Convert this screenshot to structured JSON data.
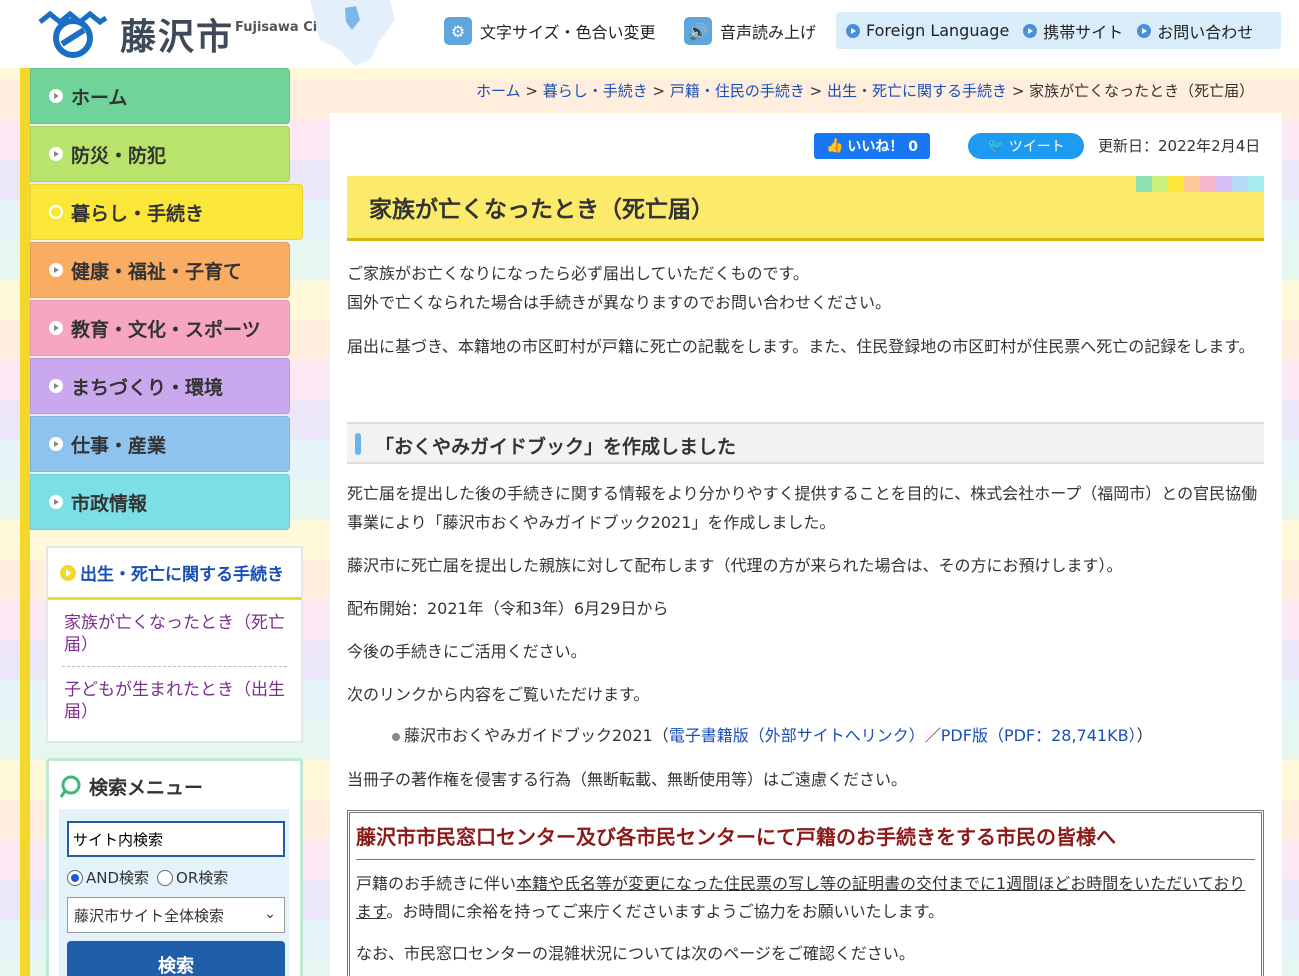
{
  "header": {
    "logo_text": "藤沢市",
    "logo_sub": "Fujisawa City",
    "tools": [
      {
        "label": "文字サイズ・色合い変更",
        "icon": "gear-icon"
      },
      {
        "label": "音声読み上げ",
        "icon": "speaker-icon"
      }
    ],
    "lang_links": [
      "Foreign Language",
      "携帯サイト",
      "お問い合わせ"
    ]
  },
  "nav": [
    {
      "label": "ホーム",
      "color": "#6fd39a"
    },
    {
      "label": "防災・防犯",
      "color": "#b8e46c"
    },
    {
      "label": "暮らし・手続き",
      "color": "#fbe73a"
    },
    {
      "label": "健康・福祉・子育て",
      "color": "#f9ad62"
    },
    {
      "label": "教育・文化・スポーツ",
      "color": "#f7a6c1"
    },
    {
      "label": "まちづくり・環境",
      "color": "#caa8ee"
    },
    {
      "label": "仕事・産業",
      "color": "#8ec3f0"
    },
    {
      "label": "市政情報",
      "color": "#7ddfe6"
    }
  ],
  "subnav": {
    "title": "出生・死亡に関する手続き",
    "items": [
      "家族が亡くなったとき（死亡届）",
      "子どもが生まれたとき（出生届）"
    ]
  },
  "search": {
    "title": "検索メニュー",
    "input_value": "サイト内検索",
    "radio_and": "AND検索",
    "radio_or": "OR検索",
    "scope": "藤沢市サイト全体検索",
    "button": "検索"
  },
  "breadcrumb": {
    "links": [
      "ホーム",
      "暮らし・手続き",
      "戸籍・住民の手続き",
      "出生・死亡に関する手続き"
    ],
    "current": "家族が亡くなったとき（死亡届）",
    "sep": ">"
  },
  "social": {
    "like": "いいね！ 0",
    "tweet": "ツイート"
  },
  "updated": "更新日：2022年2月4日",
  "title": "家族が亡くなったとき（死亡届）",
  "intro": [
    "ご家族がお亡くなりになったら必ず届出していただくものです。",
    "国外で亡くなられた場合は手続きが異なりますのでお問い合わせください。"
  ],
  "para2": "届出に基づき、本籍地の市区町村が戸籍に死亡の記載をします。また、住民登録地の市区町村が住民票へ死亡の記録をします。",
  "section_heading": "「おくやみガイドブック」を作成しました",
  "section": {
    "p1": "死亡届を提出した後の手続きに関する情報をより分かりやすく提供することを目的に、株式会社ホープ（福岡市）との官民協働事業により「藤沢市おくやみガイドブック2021」を作成しました。",
    "p2": "藤沢市に死亡届を提出した親族に対して配布します（代理の方が来られた場合は、その方にお預けします）。",
    "p3": "配布開始：2021年（令和3年）6月29日から",
    "p4": "今後の手続きにご活用ください。",
    "p5": "次のリンクから内容をご覧いただけます。",
    "bullet_prefix": "藤沢市おくやみガイドブック2021（",
    "bullet_link1": "電子書籍版（外部サイトへリンク）",
    "bullet_mid": "／",
    "bullet_link2": "PDF版（PDF：28,741KB）",
    "bullet_suffix": "）",
    "p6": "当冊子の著作権を侵害する行為（無断転載、無断使用等）はご遠慮ください。"
  },
  "notice": {
    "title": "藤沢市市民窓口センター及び各市民センターにて戸籍のお手続きをする市民の皆様へ",
    "b1_pre": "戸籍のお手続きに伴い",
    "b1_under": "本籍や氏名等が変更になった住民票の写し等の証明書の交付までに1週間ほどお時間をいただいております",
    "b1_post": "。お時間に余裕を持ってご来庁くださいますようご協力をお願いいたします。",
    "b2": "なお、市民窓口センターの混雑状況については次のページをご確認ください。"
  }
}
